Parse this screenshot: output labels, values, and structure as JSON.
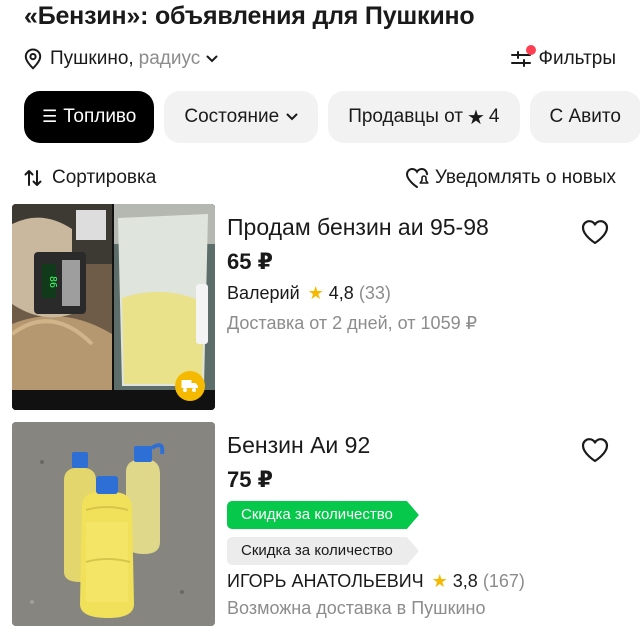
{
  "header": {
    "title": "«Бензин»: объявления для Пушкино",
    "location": "Пушкино,",
    "radius": "радиус",
    "filters_label": "Фильтры"
  },
  "chips": {
    "fuel": "Топливо",
    "condition": "Состояние",
    "sellers_prefix": "Продавцы от",
    "sellers_rating": "4",
    "avito": "С Авито"
  },
  "sort_row": {
    "sort_label": "Сортировка",
    "notify_label": "Уведомлять о новых"
  },
  "listings": [
    {
      "title": "Продам бензин аи 95-98",
      "price": "65 ₽",
      "seller": "Валерий",
      "rating": "4,8",
      "reviews": "(33)",
      "delivery": "Доставка от 2 дней, от 1059 ₽"
    },
    {
      "title": "Бензин Аи 92",
      "price": "75 ₽",
      "badge_green": "Скидка за количество",
      "badge_gray": "Скидка за количество",
      "seller": "ИГОРЬ АНАТОЛЬЕВИЧ",
      "rating": "3,8",
      "reviews": "(167)",
      "delivery": "Возможна доставка в Пушкино"
    }
  ],
  "photo1": {
    "display_reading": "86"
  },
  "colors": {
    "accent_green": "#06c84a",
    "star_gold": "#f5b900",
    "notification_dot": "#ff4053",
    "delivery_badge": "#f5b900",
    "active_chip": "#000000"
  }
}
